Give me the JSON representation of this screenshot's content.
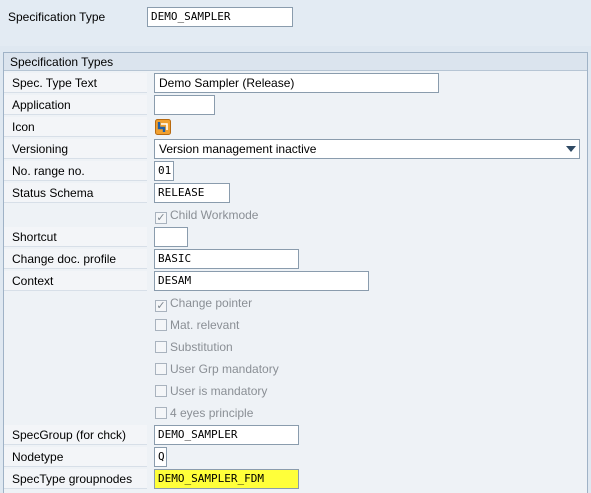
{
  "header": {
    "spec_type_label": "Specification Type",
    "spec_type_value": "DEMO_SAMPLER"
  },
  "group": {
    "title": "Specification Types",
    "spec_type_text_label": "Spec. Type Text",
    "spec_type_text_value": "Demo Sampler (Release)",
    "application_label": "Application",
    "application_value": "",
    "icon_label": "Icon",
    "versioning_label": "Versioning",
    "versioning_value": "Version management inactive",
    "no_range_label": "No. range no.",
    "no_range_value": "01",
    "status_schema_label": "Status Schema",
    "status_schema_value": "RELEASE",
    "child_workmode": {
      "label": "Child Workmode",
      "checked": true
    },
    "shortcut_label": "Shortcut",
    "shortcut_value": "",
    "change_doc_label": "Change doc. profile",
    "change_doc_value": "BASIC",
    "context_label": "Context",
    "context_value": "DESAM",
    "change_pointer": {
      "label": "Change pointer",
      "checked": true
    },
    "mat_relevant": {
      "label": "Mat. relevant",
      "checked": false
    },
    "substitution": {
      "label": "Substitution",
      "checked": false
    },
    "user_grp_mandatory": {
      "label": "User Grp mandatory",
      "checked": false
    },
    "user_is_mandatory": {
      "label": "User is mandatory",
      "checked": false
    },
    "four_eyes": {
      "label": "4 eyes principle",
      "checked": false
    },
    "specgroup_label": "SpecGroup (for chck)",
    "specgroup_value": "DEMO_SAMPLER",
    "nodetype_label": "Nodetype",
    "nodetype_value": "Q",
    "spectype_groupnodes_label": "SpecType groupnodes",
    "spectype_groupnodes_value": "DEMO_SAMPLER_FDM"
  },
  "icons": {
    "icon_field": "spec-type-icon",
    "dropdown": "chevron-down-icon",
    "check": "checkmark-icon"
  },
  "colors": {
    "highlight": "#ffff3a",
    "background": "#dfe8f1"
  }
}
